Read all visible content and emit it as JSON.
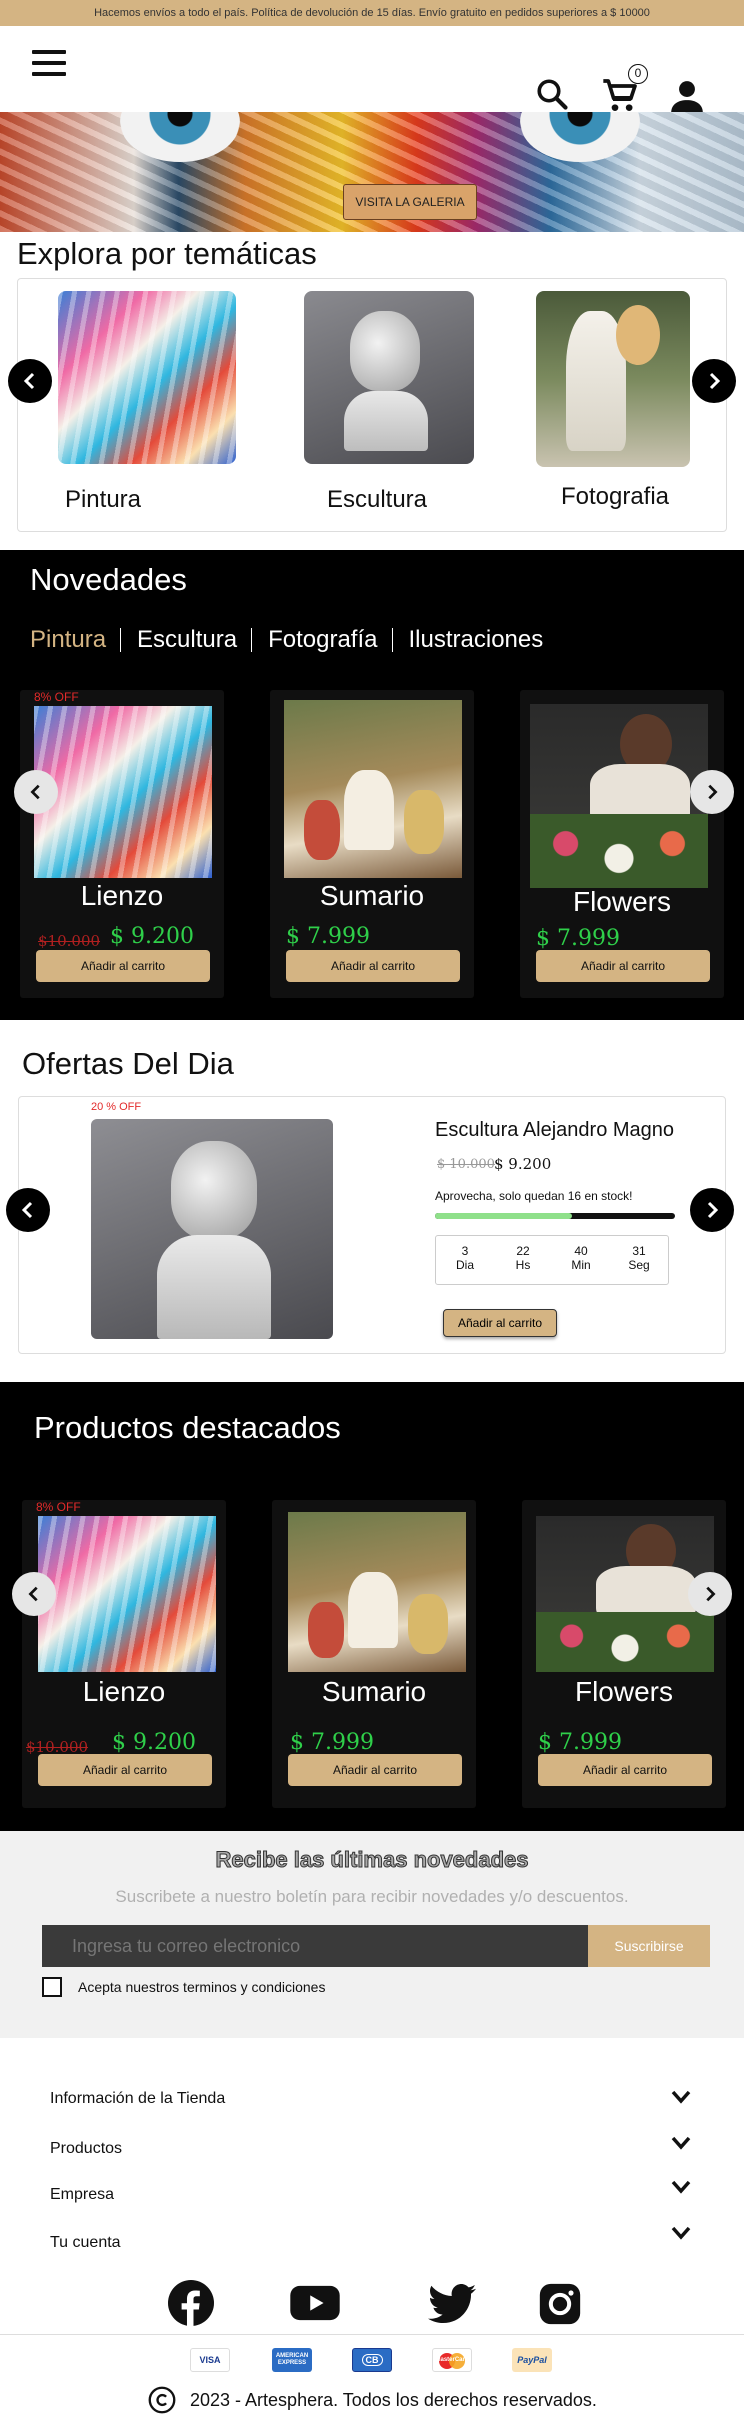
{
  "topbar": {
    "text": "Hacemos envíos a todo el país. Política de devolución de 15 días. Envío gratuito en pedidos superiores a $ 10000"
  },
  "header": {
    "cart_count": "0"
  },
  "hero": {
    "button": "VISITA LA GALERIA"
  },
  "categories": {
    "title": "Explora por temáticas",
    "items": [
      {
        "label": "Pintura"
      },
      {
        "label": "Escultura"
      },
      {
        "label": "Fotografia"
      }
    ]
  },
  "novedades": {
    "title": "Novedades",
    "tabs": [
      "Pintura",
      "Escultura",
      "Fotografía",
      "Ilustraciones"
    ],
    "active_color": "#d4b483",
    "products": [
      {
        "badge": "8% OFF",
        "name": "Lienzo",
        "old_price": "$10.000",
        "price": "$ 9.200",
        "button": "Añadir al carrito"
      },
      {
        "badge": "",
        "name": "Sumario",
        "old_price": "",
        "price": "$ 7.999",
        "button": "Añadir al carrito"
      },
      {
        "badge": "",
        "name": "Flowers",
        "old_price": "",
        "price": "$ 7.999",
        "button": "Añadir al carrito"
      }
    ]
  },
  "offers": {
    "title": "Ofertas Del Dia",
    "badge": "20 % OFF",
    "product_name": "Escultura Alejandro Magno",
    "old_price": "$ 10.000",
    "price": "$ 9.200",
    "stock_text": "Aprovecha, solo quedan 16 en stock!",
    "stock_fraction": 0.57,
    "countdown": [
      {
        "value": "3",
        "unit": "Dia"
      },
      {
        "value": "22",
        "unit": "Hs"
      },
      {
        "value": "40",
        "unit": "Min"
      },
      {
        "value": "31",
        "unit": "Seg"
      }
    ],
    "button": "Añadir al carrito"
  },
  "featured": {
    "title": "Productos destacados",
    "products": [
      {
        "badge": "8% OFF",
        "name": "Lienzo",
        "old_price": "$10.000",
        "price": "$ 9.200",
        "button": "Añadir al carrito"
      },
      {
        "badge": "",
        "name": "Sumario",
        "old_price": "",
        "price": "$ 7.999",
        "button": "Añadir al carrito"
      },
      {
        "badge": "",
        "name": "Flowers",
        "old_price": "",
        "price": "$ 7.999",
        "button": "Añadir al carrito"
      }
    ]
  },
  "newsletter": {
    "title": "Recibe las últimas novedades",
    "subtitle": "Suscribete a nuestro boletín para recibir novedades y/o descuentos.",
    "placeholder": "Ingresa tu correo electronico",
    "button": "Suscribirse",
    "terms": "Acepta nuestros terminos y condiciones"
  },
  "footer": {
    "sections": [
      "Información de la Tienda",
      "Productos",
      "Empresa",
      "Tu cuenta"
    ],
    "social": [
      "facebook-icon",
      "youtube-icon",
      "twitter-icon",
      "instagram-icon"
    ],
    "payments": [
      "VISA",
      "AMERICAN EXPRESS",
      "CB",
      "MasterCard",
      "PayPal"
    ],
    "copyright": "2023 - Artesphera. Todos los derechos reservados."
  }
}
